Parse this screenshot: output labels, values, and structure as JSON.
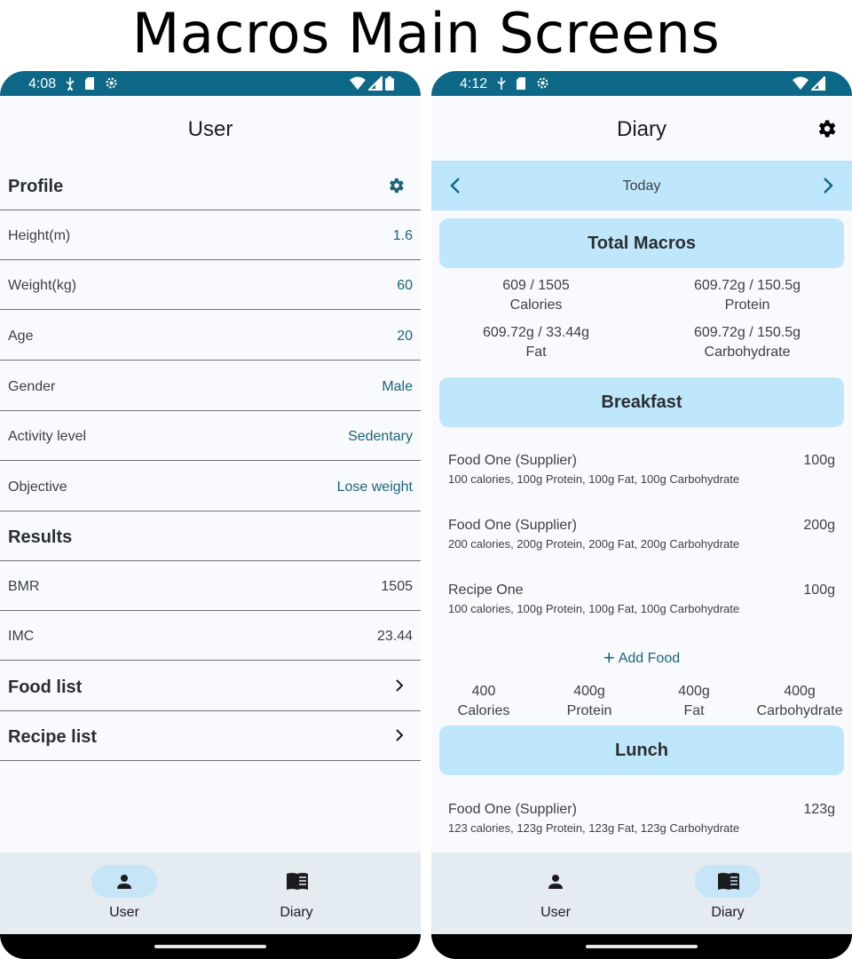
{
  "page_title": "Macros Main Screens",
  "left_phone": {
    "status_time": "4:08",
    "title": "User",
    "rows": [
      {
        "label": "Profile"
      },
      {
        "label": "Height(m)",
        "value": "1.6"
      },
      {
        "label": "Weight(kg)",
        "value": "60"
      },
      {
        "label": "Age",
        "value": "20"
      },
      {
        "label": "Gender",
        "value": "Male"
      },
      {
        "label": "Activity level",
        "value": "Sedentary"
      },
      {
        "label": "Objective",
        "value": "Lose weight"
      },
      {
        "label": "Results"
      },
      {
        "label": "BMR",
        "value": "1505"
      },
      {
        "label": "IMC",
        "value": "23.44"
      },
      {
        "label": "Food list"
      },
      {
        "label": "Recipe list"
      }
    ],
    "nav": {
      "user": "User",
      "diary": "Diary",
      "active": "User"
    }
  },
  "right_phone": {
    "status_time": "4:12",
    "title": "Diary",
    "date_label": "Today",
    "total_macros": {
      "title": "Total Macros",
      "calories_value": "609 / 1505",
      "calories_label": "Calories",
      "protein_value": "609.72g / 150.5g",
      "protein_label": "Protein",
      "fat_value": "609.72g / 33.44g",
      "fat_label": "Fat",
      "carbs_value": "609.72g / 150.5g",
      "carbs_label": "Carbohydrate"
    },
    "breakfast": {
      "title": "Breakfast",
      "items": [
        {
          "name": "Food One (Supplier)",
          "qty": "100g",
          "detail": "100 calories, 100g Protein, 100g Fat, 100g Carbohydrate"
        },
        {
          "name": "Food One (Supplier)",
          "qty": "200g",
          "detail": "200 calories, 200g Protein, 200g Fat, 200g Carbohydrate"
        },
        {
          "name": "Recipe One",
          "qty": "100g",
          "detail": "100 calories, 100g Protein, 100g Fat, 100g Carbohydrate"
        }
      ],
      "add_food": "Add Food",
      "totals": [
        {
          "value": "400",
          "label": "Calories"
        },
        {
          "value": "400g",
          "label": "Protein"
        },
        {
          "value": "400g",
          "label": "Fat"
        },
        {
          "value": "400g",
          "label": "Carbohydrate"
        }
      ]
    },
    "lunch": {
      "title": "Lunch",
      "items": [
        {
          "name": "Food One (Supplier)",
          "qty": "123g",
          "detail": "123 calories, 123g Protein, 123g Fat, 123g Carbohydrate"
        }
      ]
    },
    "nav": {
      "user": "User",
      "diary": "Diary",
      "active": "Diary"
    }
  },
  "colors": {
    "status_bar": "#0d6786",
    "accent": "#1c637a",
    "section_bg": "#bfe7fc",
    "nav_bg": "#e4ebf1",
    "nav_active_pill": "#c6e6f8"
  }
}
